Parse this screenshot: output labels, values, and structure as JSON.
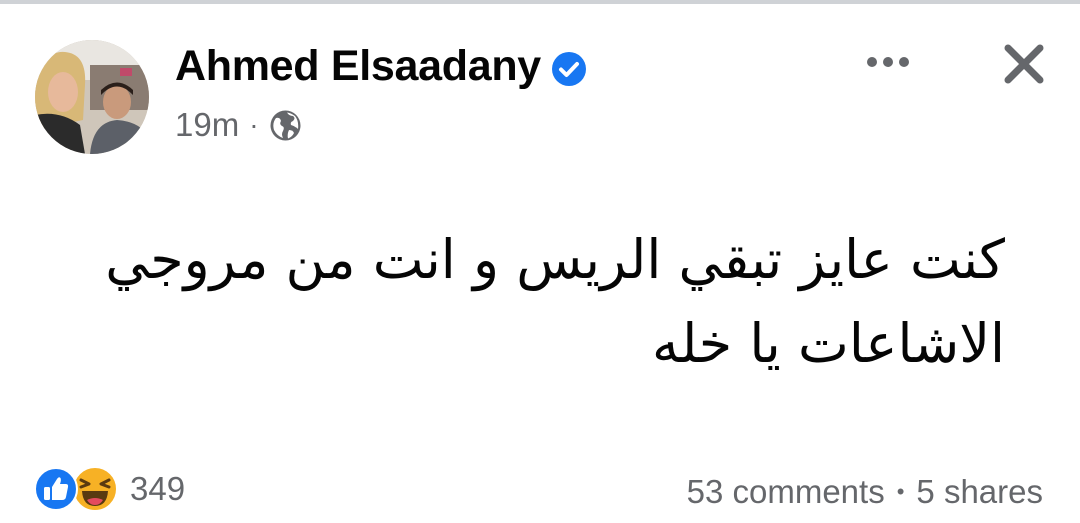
{
  "post": {
    "author": "Ahmed Elsaadany",
    "time": "19m",
    "separator": "·",
    "text_line1": "كنت عايز تبقي الريس و انت من مروجي",
    "text_line2": "الاشاعات يا خله"
  },
  "footer": {
    "reaction_count": "349",
    "comments": "53 comments",
    "separator": "•",
    "shares": "5 shares"
  },
  "icons": {
    "verified": "verified-badge-icon",
    "privacy": "globe-icon",
    "more": "more-icon",
    "close": "close-icon",
    "like": "like-reaction-icon",
    "haha": "haha-reaction-icon"
  },
  "colors": {
    "verified_blue": "#1877f2",
    "meta_gray": "#65676b",
    "text": "#050505",
    "haha_yellow": "#f7b125"
  }
}
